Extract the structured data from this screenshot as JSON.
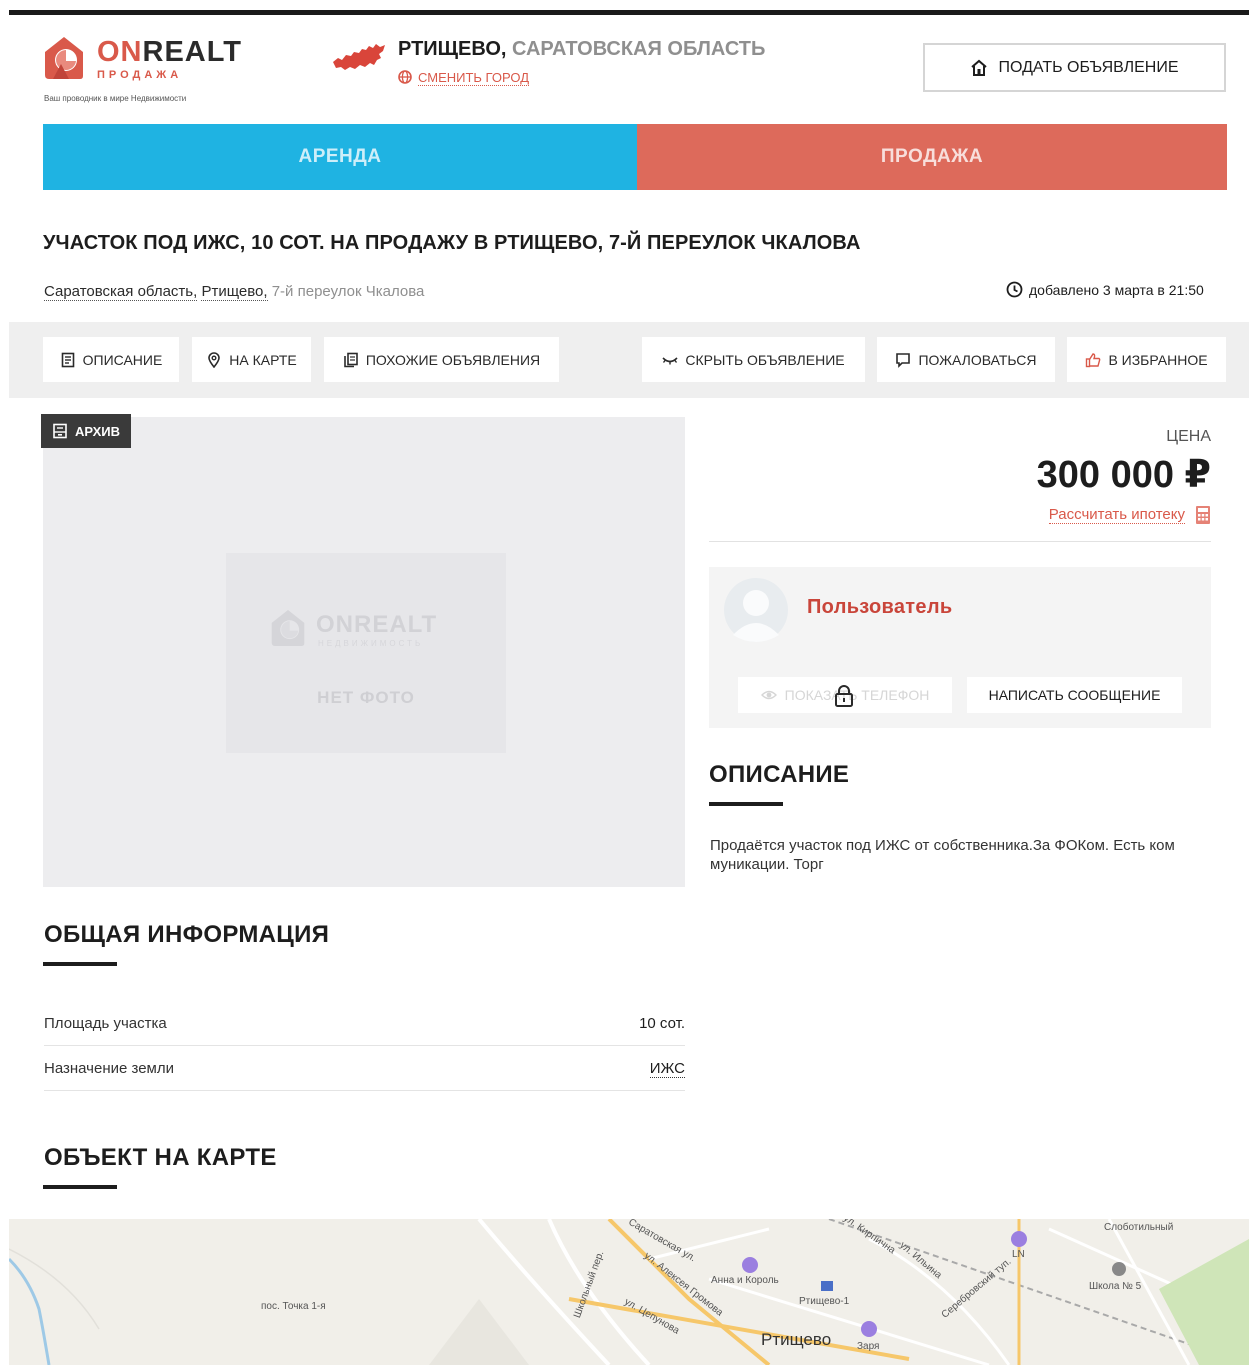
{
  "header": {
    "logo_name_part1": "ON",
    "logo_name_part2": "REALT",
    "logo_sub": "ПРОДАЖА",
    "logo_tagline": "Ваш проводник в мире Недвижимости",
    "city": "РТИЩЕВО,",
    "region": "САРАТОВСКАЯ ОБЛАСТЬ",
    "change_city": "СМЕНИТЬ ГОРОД",
    "post_button": "ПОДАТЬ ОБЪЯВЛЕНИЕ"
  },
  "tabs": [
    {
      "label": "АРЕНДА",
      "color": "#1fb3e2"
    },
    {
      "label": "ПРОДАЖА",
      "color": "#dd6a5b"
    }
  ],
  "listing": {
    "title": "УЧАСТОК ПОД ИЖС, 10 СОТ. НА ПРОДАЖУ В РТИЩЕВО, 7-Й ПЕРЕУЛОК ЧКАЛОВА",
    "region_link": "Саратовская область,",
    "city_link": "Ртищево,",
    "street": "7-й переулок Чкалова",
    "added": "добавлено 3 марта в 21:50"
  },
  "actions": {
    "description": "ОПИСАНИЕ",
    "on_map": "НА КАРТЕ",
    "similar": "ПОХОЖИЕ ОБЪЯВЛЕНИЯ",
    "hide": "СКРЫТЬ ОБЪЯВЛЕНИЕ",
    "report": "ПОЖАЛОВАТЬСЯ",
    "favorite": "В ИЗБРАННОЕ"
  },
  "photo": {
    "archive_badge": "АРХИВ",
    "placeholder_logo": "ONREALT",
    "placeholder_logo_sub": "НЕДВИЖИМОСТЬ",
    "no_photo": "НЕТ ФОТО"
  },
  "price": {
    "label": "ЦЕНА",
    "value": "300 000 ₽",
    "mortgage_link": "Рассчитать ипотеку"
  },
  "seller": {
    "name": "Пользователь",
    "show_phone": "ПОКАЗАТЬ ТЕЛЕФОН",
    "write_message": "НАПИСАТЬ СООБЩЕНИЕ"
  },
  "description": {
    "heading": "ОПИСАНИЕ",
    "text": "Продаётся участок под  ИЖС от собственника.За ФОКом. Есть ком муникации. Торг"
  },
  "general_info": {
    "heading": "ОБЩАЯ ИНФОРМАЦИЯ",
    "rows": [
      {
        "key": "Площадь участка",
        "value": "10 сот."
      },
      {
        "key": "Назначение земли",
        "value": "ИЖС"
      }
    ]
  },
  "map": {
    "heading": "ОБЪЕКТ НА КАРТЕ",
    "city_label": "Ртищево",
    "labels": [
      "пос. Точка 1-я",
      "Саратовская ул.",
      "ул. Алексея Громова",
      "ул. Цепунова",
      "Школьный пер.",
      "Анна и Король",
      "Ртищево-1",
      "ул. Кирпична",
      "ул. Ильина",
      "Серебровский туп.",
      "Школа № 5",
      "Заря",
      "LN",
      "Слоботильный"
    ]
  },
  "colors": {
    "accent_red": "#d9594a",
    "rent_blue": "#1fb3e2",
    "sale_red": "#dd6a5b"
  }
}
